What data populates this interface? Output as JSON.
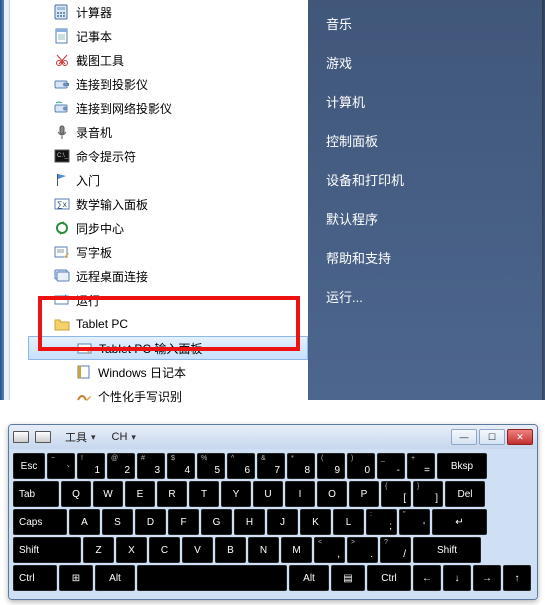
{
  "start_menu": {
    "left_items": [
      {
        "icon": "calculator",
        "label": "计算器"
      },
      {
        "icon": "notepad",
        "label": "记事本"
      },
      {
        "icon": "snipping",
        "label": "截图工具"
      },
      {
        "icon": "projector",
        "label": "连接到投影仪"
      },
      {
        "icon": "net-projector",
        "label": "连接到网络投影仪"
      },
      {
        "icon": "mic",
        "label": "录音机"
      },
      {
        "icon": "cmd",
        "label": "命令提示符"
      },
      {
        "icon": "flag",
        "label": "入门"
      },
      {
        "icon": "math-input",
        "label": "数学输入面板"
      },
      {
        "icon": "sync",
        "label": "同步中心"
      },
      {
        "icon": "tablet-pen",
        "label": "写字板"
      },
      {
        "icon": "rdp",
        "label": "远程桌面连接"
      },
      {
        "icon": "run",
        "label": "运行"
      },
      {
        "icon": "folder",
        "label": "Tablet PC",
        "expanded": true
      },
      {
        "icon": "tablet-input",
        "label": "Tablet PC 输入面板",
        "sub": true,
        "selected": true
      },
      {
        "icon": "journal",
        "label": "Windows 日记本",
        "sub": true
      },
      {
        "icon": "handwriting",
        "label": "个性化手写识别",
        "sub": true
      }
    ],
    "right_items": [
      "音乐",
      "游戏",
      "计算机",
      "控制面板",
      "设备和打印机",
      "默认程序",
      "帮助和支持",
      "运行..."
    ]
  },
  "osk": {
    "toolbar": {
      "tools": "工具",
      "lang": "CH"
    },
    "window_buttons": {
      "min": "—",
      "max": "☐",
      "close": "✕"
    },
    "rows": [
      [
        {
          "sub": "",
          "main": "Esc",
          "w": 32
        },
        {
          "sub": "~",
          "main": "`",
          "w": 28
        },
        {
          "sub": "!",
          "main": "1",
          "w": 28
        },
        {
          "sub": "@",
          "main": "2",
          "w": 28
        },
        {
          "sub": "#",
          "main": "3",
          "w": 28
        },
        {
          "sub": "$",
          "main": "4",
          "w": 28
        },
        {
          "sub": "%",
          "main": "5",
          "w": 28
        },
        {
          "sub": "^",
          "main": "6",
          "w": 28
        },
        {
          "sub": "&",
          "main": "7",
          "w": 28
        },
        {
          "sub": "*",
          "main": "8",
          "w": 28
        },
        {
          "sub": "(",
          "main": "9",
          "w": 28
        },
        {
          "sub": ")",
          "main": "0",
          "w": 28
        },
        {
          "sub": "_",
          "main": "-",
          "w": 28
        },
        {
          "sub": "+",
          "main": "=",
          "w": 28
        },
        {
          "sub": "",
          "main": "Bksp",
          "w": 50
        }
      ],
      [
        {
          "main": "Tab",
          "w": 46,
          "align": "left"
        },
        {
          "main": "Q",
          "w": 30
        },
        {
          "main": "W",
          "w": 30
        },
        {
          "main": "E",
          "w": 30
        },
        {
          "main": "R",
          "w": 30
        },
        {
          "main": "T",
          "w": 30
        },
        {
          "main": "Y",
          "w": 30
        },
        {
          "main": "U",
          "w": 30
        },
        {
          "main": "I",
          "w": 30
        },
        {
          "main": "O",
          "w": 30
        },
        {
          "main": "P",
          "w": 30
        },
        {
          "sub": "{",
          "main": "[",
          "w": 30
        },
        {
          "sub": "}",
          "main": "]",
          "w": 30
        },
        {
          "main": "Del",
          "w": 40
        }
      ],
      [
        {
          "main": "Caps",
          "w": 54,
          "align": "left"
        },
        {
          "main": "A",
          "w": 31
        },
        {
          "main": "S",
          "w": 31
        },
        {
          "main": "D",
          "w": 31
        },
        {
          "main": "F",
          "w": 31
        },
        {
          "main": "G",
          "w": 31
        },
        {
          "main": "H",
          "w": 31
        },
        {
          "main": "J",
          "w": 31
        },
        {
          "main": "K",
          "w": 31
        },
        {
          "main": "L",
          "w": 31
        },
        {
          "sub": ":",
          "main": ";",
          "w": 31
        },
        {
          "sub": "\"",
          "main": "'",
          "w": 31
        },
        {
          "main": "↵",
          "w": 55
        }
      ],
      [
        {
          "main": "Shift",
          "w": 68,
          "align": "left"
        },
        {
          "main": "Z",
          "w": 31
        },
        {
          "main": "X",
          "w": 31
        },
        {
          "main": "C",
          "w": 31
        },
        {
          "main": "V",
          "w": 31
        },
        {
          "main": "B",
          "w": 31
        },
        {
          "main": "N",
          "w": 31
        },
        {
          "main": "M",
          "w": 31
        },
        {
          "sub": "<",
          "main": ",",
          "w": 31
        },
        {
          "sub": ">",
          "main": ".",
          "w": 31
        },
        {
          "sub": "?",
          "main": "/",
          "w": 31
        },
        {
          "main": "Shift",
          "w": 68
        }
      ],
      [
        {
          "main": "Ctrl",
          "w": 44,
          "align": "left"
        },
        {
          "main": "⊞",
          "w": 34
        },
        {
          "main": "Alt",
          "w": 40
        },
        {
          "main": "",
          "w": 150
        },
        {
          "main": "Alt",
          "w": 40
        },
        {
          "main": "▤",
          "w": 34
        },
        {
          "main": "Ctrl",
          "w": 44
        },
        {
          "main": "←",
          "w": 28
        },
        {
          "main": "↓",
          "w": 28
        },
        {
          "main": "→",
          "w": 28
        },
        {
          "main": "↑",
          "w": 28
        }
      ]
    ]
  }
}
